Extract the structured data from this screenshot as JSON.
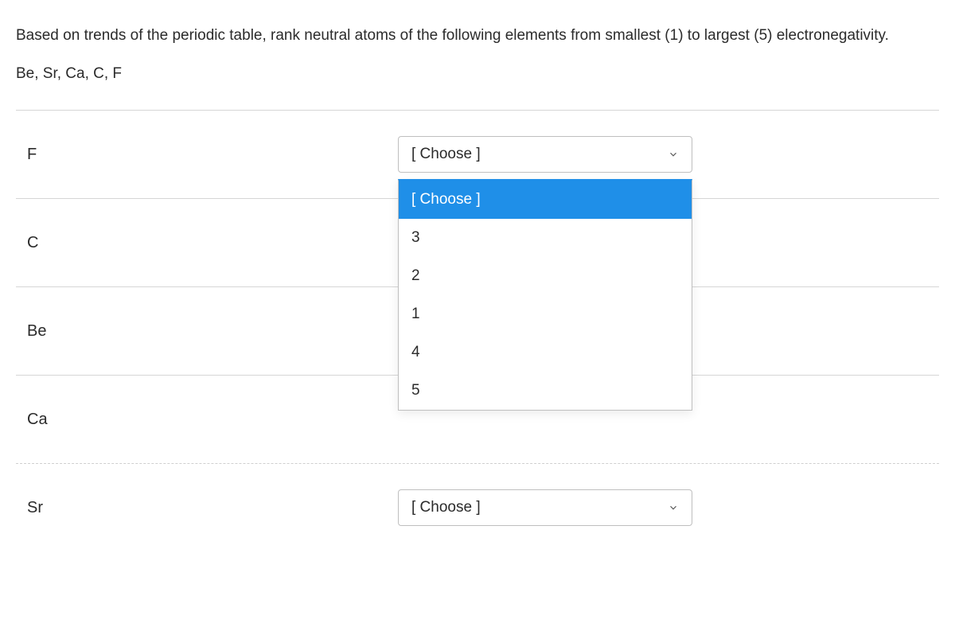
{
  "question": {
    "text": "Based on trends of the periodic table, rank neutral atoms of the following elements from smallest (1) to largest (5) electronegativity.",
    "elements": "Be, Sr, Ca, C, F"
  },
  "choose_placeholder": "[ Choose ]",
  "rows": [
    {
      "label": "F"
    },
    {
      "label": "C"
    },
    {
      "label": "Be"
    },
    {
      "label": "Ca"
    },
    {
      "label": "Sr"
    }
  ],
  "dropdown_options": [
    "[ Choose ]",
    "3",
    "2",
    "1",
    "4",
    "5"
  ]
}
